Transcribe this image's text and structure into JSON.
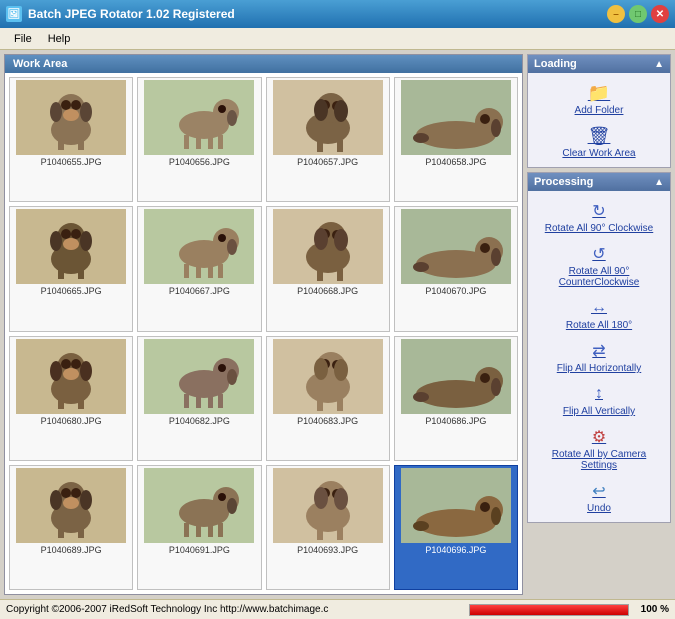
{
  "titlebar": {
    "title": "Batch JPEG Rotator 1.02 Registered",
    "icon": "🖼",
    "min_label": "–",
    "max_label": "□",
    "close_label": "✕"
  },
  "menubar": {
    "items": [
      {
        "label": "File",
        "id": "file"
      },
      {
        "label": "Help",
        "id": "help"
      }
    ]
  },
  "workarea": {
    "title": "Work Area"
  },
  "loading_panel": {
    "header": "Loading",
    "add_folder_label": "Add Folder",
    "clear_work_area_label": "Clear Work Area"
  },
  "processing_panel": {
    "header": "Processing",
    "buttons": [
      {
        "label": "Rotate All 90° Clockwise",
        "icon": "↻",
        "id": "rot-cw"
      },
      {
        "label": "Rotate All 90° CounterClockwise",
        "icon": "↺",
        "id": "rot-ccw"
      },
      {
        "label": "Rotate All 180°",
        "icon": "⇄",
        "id": "rot-180"
      },
      {
        "label": "Flip All Horizontally",
        "icon": "↔",
        "id": "flip-h"
      },
      {
        "label": "Flip All Vertically",
        "icon": "↕",
        "id": "flip-v"
      },
      {
        "label": "Rotate All by Camera Settings",
        "icon": "⚙",
        "id": "rot-cam"
      },
      {
        "label": "Undo",
        "icon": "↩",
        "id": "undo"
      }
    ]
  },
  "images": [
    {
      "filename": "P1040655.JPG",
      "selected": false,
      "color1": "#8b7355",
      "color2": "#5a4535"
    },
    {
      "filename": "P1040656.JPG",
      "selected": false,
      "color1": "#9b8365",
      "color2": "#6a5545"
    },
    {
      "filename": "P1040657.JPG",
      "selected": false,
      "color1": "#7b6345",
      "color2": "#4a3525"
    },
    {
      "filename": "P1040658.JPG",
      "selected": false,
      "color1": "#8a7050",
      "color2": "#5a4030"
    },
    {
      "filename": "P1040665.JPG",
      "selected": false,
      "color1": "#6b5535",
      "color2": "#4a3525"
    },
    {
      "filename": "P1040667.JPG",
      "selected": false,
      "color1": "#9a8060",
      "color2": "#6a5040"
    },
    {
      "filename": "P1040668.JPG",
      "selected": false,
      "color1": "#7a6040",
      "color2": "#5a4030"
    },
    {
      "filename": "P1040670.JPG",
      "selected": false,
      "color1": "#8b7050",
      "color2": "#5a4030"
    },
    {
      "filename": "P1040680.JPG",
      "selected": false,
      "color1": "#7a6040",
      "color2": "#4a3020"
    },
    {
      "filename": "P1040682.JPG",
      "selected": false,
      "color1": "#8a7060",
      "color2": "#6a5040"
    },
    {
      "filename": "P1040683.JPG",
      "selected": false,
      "color1": "#9a8060",
      "color2": "#7a6040"
    },
    {
      "filename": "P1040686.JPG",
      "selected": false,
      "color1": "#7a6040",
      "color2": "#5a4030"
    },
    {
      "filename": "P1040689.JPG",
      "selected": false,
      "color1": "#7b6345",
      "color2": "#4a3525"
    },
    {
      "filename": "P1040691.JPG",
      "selected": false,
      "color1": "#8b7355",
      "color2": "#5a4535"
    },
    {
      "filename": "P1040693.JPG",
      "selected": false,
      "color1": "#9b8060",
      "color2": "#6a5040"
    },
    {
      "filename": "P1040696.JPG",
      "selected": true,
      "color1": "#8a6840",
      "color2": "#5a4020"
    }
  ],
  "statusbar": {
    "text": "Copyright ©2006-2007  iRedSoft Technology Inc  http://www.batchimage.c",
    "progress_pct": 100,
    "progress_label": "100 %"
  }
}
